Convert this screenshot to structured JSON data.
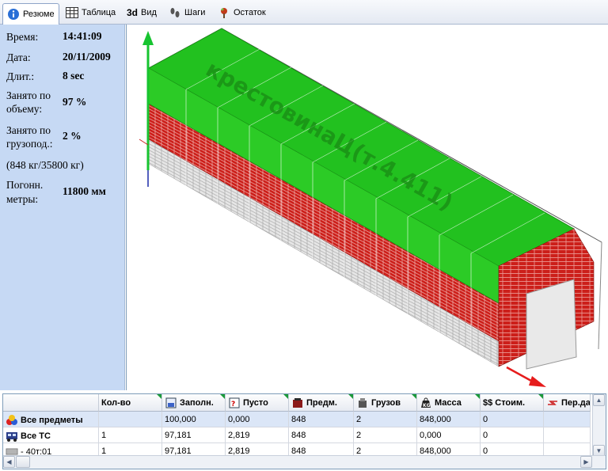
{
  "toolbar": {
    "tabs": [
      {
        "label": "Резюме",
        "icon": "info-icon",
        "active": true
      },
      {
        "label": "Таблица",
        "icon": "table-icon",
        "active": false
      },
      {
        "label": "Вид",
        "icon": "3d-icon",
        "prefix": "3d",
        "active": false
      },
      {
        "label": "Шаги",
        "icon": "steps-icon",
        "active": false
      },
      {
        "label": "Остаток",
        "icon": "remainder-icon",
        "active": false
      }
    ]
  },
  "summary": {
    "time_label": "Время:",
    "time_value": "14:41:09",
    "date_label": "Дата:",
    "date_value": "20/11/2009",
    "duration_label": "Длит.:",
    "duration_value": "8 sec",
    "volume_label_1": "Занято по",
    "volume_label_2": "объему:",
    "volume_value": "97 %",
    "load_label_1": "Занято по",
    "load_label_2": "грузопод.:",
    "load_value": "2 %",
    "load_detail": "(848 кг/35800 кг)",
    "meters_label_1": "Погонн.",
    "meters_label_2": "метры:",
    "meters_value": "11800 мм"
  },
  "view3d": {
    "cargo_label": "крестовинаЦ(т.4.411)",
    "colors": {
      "top": "#22c11f",
      "brick": "#cc1f1a",
      "white": "#e3e3e3",
      "axis_green": "#17c430",
      "axis_red": "#e61c1c",
      "axis_blue": "#1a2aa8"
    }
  },
  "grid": {
    "headers": [
      {
        "label": "",
        "icon": ""
      },
      {
        "label": "Кол-во",
        "icon": ""
      },
      {
        "label": "Заполн.",
        "icon": "fill-icon"
      },
      {
        "label": "Пусто",
        "icon": "empty-icon"
      },
      {
        "label": "Предм.",
        "icon": "items-icon"
      },
      {
        "label": "Грузов",
        "icon": "cargo-icon"
      },
      {
        "label": "Масса",
        "icon": "mass-icon"
      },
      {
        "label": "Стоим.",
        "icon": "cost-icon",
        "prefix": "$$"
      },
      {
        "label": "Пер.дан",
        "icon": "transfer-icon"
      }
    ],
    "rows": [
      {
        "name": "Все предметы",
        "icon": "all-items-icon",
        "cells": [
          "",
          "100,000",
          "0,000",
          "848",
          "2",
          "848,000",
          "0",
          ""
        ],
        "selected": true
      },
      {
        "name": "Все ТС",
        "icon": "all-vehicles-icon",
        "cells": [
          "1",
          "97,181",
          "2,819",
          "848",
          "2",
          "0,000",
          "0",
          ""
        ],
        "selected": false
      },
      {
        "name": "- 40т:01",
        "icon": "truck-icon",
        "cells": [
          "1",
          "97,181",
          "2,819",
          "848",
          "2",
          "848,000",
          "0",
          ""
        ],
        "selected": false
      }
    ]
  }
}
